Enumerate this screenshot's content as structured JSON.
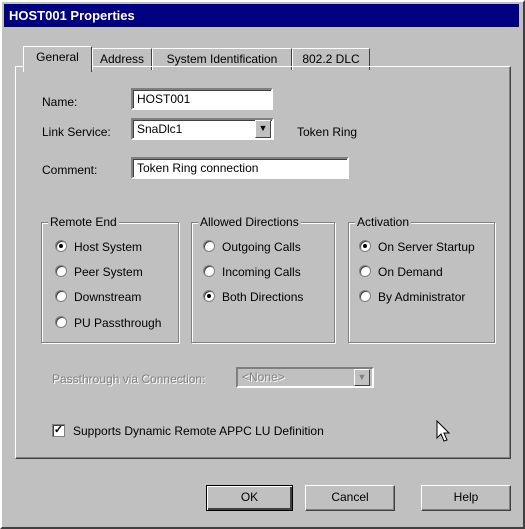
{
  "window": {
    "title": "HOST001 Properties"
  },
  "tabs": [
    "General",
    "Address",
    "System Identification",
    "802.2 DLC"
  ],
  "form": {
    "name_label": "Name:",
    "name_value": "HOST001",
    "link_service_label": "Link Service:",
    "link_service_value": "SnaDlc1",
    "link_service_type": "Token Ring",
    "comment_label": "Comment:",
    "comment_value": "Token Ring connection"
  },
  "remote_end": {
    "legend": "Remote End",
    "options": [
      "Host System",
      "Peer System",
      "Downstream",
      "PU Passthrough"
    ],
    "selected": "Host System"
  },
  "allowed_directions": {
    "legend": "Allowed Directions",
    "options": [
      "Outgoing Calls",
      "Incoming Calls",
      "Both Directions"
    ],
    "selected": "Both Directions"
  },
  "activation": {
    "legend": "Activation",
    "options": [
      "On Server Startup",
      "On Demand",
      "By Administrator"
    ],
    "selected": "On Server Startup"
  },
  "passthrough": {
    "label": "Passthrough via Connection:",
    "value": "<None>"
  },
  "supports_dynamic": {
    "label": "Supports Dynamic Remote APPC LU Definition",
    "checked": true
  },
  "buttons": {
    "ok": "OK",
    "cancel": "Cancel",
    "help": "Help"
  },
  "icons": {
    "dropdown": "chevron-down-icon",
    "cursor": "mouse-pointer-icon"
  }
}
